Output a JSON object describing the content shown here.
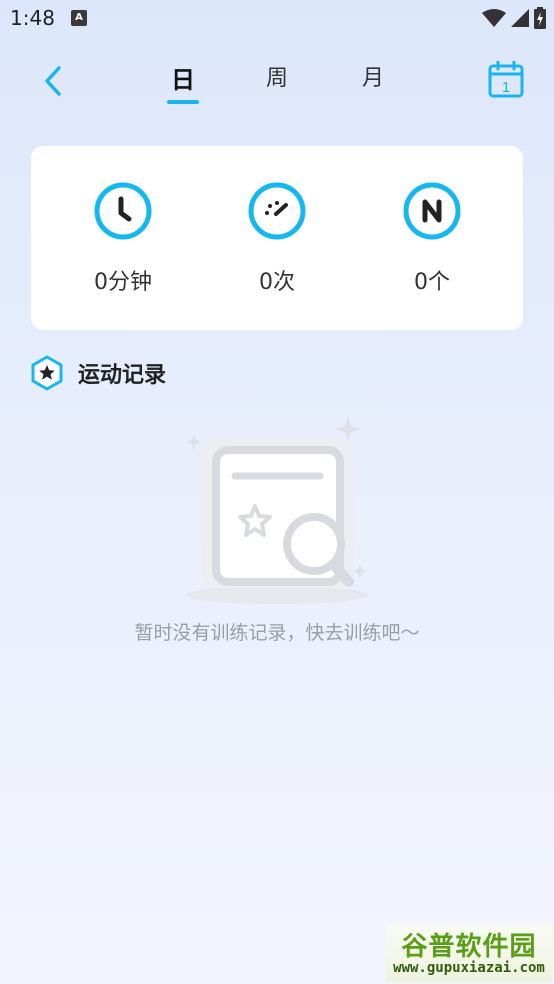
{
  "status_bar": {
    "time": "1:48",
    "notification_icon": "A",
    "icons": [
      "wifi-icon",
      "signal-icon",
      "battery-charging-icon"
    ]
  },
  "nav": {
    "back_icon": "chevron-left-icon",
    "tabs": [
      {
        "label": "日",
        "active": true
      },
      {
        "label": "周",
        "active": false
      },
      {
        "label": "月",
        "active": false
      }
    ],
    "calendar_day": "1",
    "accent_color": "#1ab4ef"
  },
  "stats": [
    {
      "icon": "clock-icon",
      "value": "0分钟"
    },
    {
      "icon": "speed-icon",
      "value": "0次"
    },
    {
      "icon": "count-n-icon",
      "value": "0个"
    }
  ],
  "records": {
    "title": "运动记录",
    "empty_text": "暂时没有训练记录，快去训练吧～"
  },
  "watermark": {
    "title": "谷普软件园",
    "url": "www.gupuxiazai.com"
  }
}
